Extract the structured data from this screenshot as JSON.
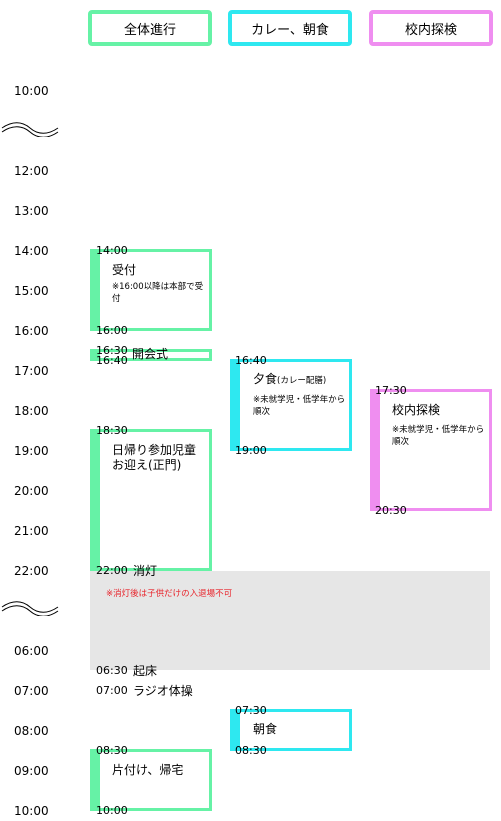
{
  "colors": {
    "general": "#66f2a6",
    "curry": "#2ee8f0",
    "tour": "#ef8ef0",
    "night": "#e6e6e6",
    "warning": "#e8232a"
  },
  "headers": {
    "general": "全体進行",
    "curry": "カレー、朝食",
    "tour": "校内探検"
  },
  "times": {
    "t1000": "10:00",
    "t1200": "12:00",
    "t1300": "13:00",
    "t1400": "14:00",
    "t1500": "15:00",
    "t1600": "16:00",
    "t1700": "17:00",
    "t1800": "18:00",
    "t1900": "19:00",
    "t2000": "20:00",
    "t2100": "21:00",
    "t2200": "22:00",
    "t0600": "06:00",
    "t0700": "07:00",
    "t0800": "08:00",
    "t0900": "09:00",
    "t1000b": "10:00"
  },
  "night_note": "※消灯後は子供だけの入退場不可",
  "events": {
    "reception": {
      "start": "14:00",
      "end": "16:00",
      "title": "受付",
      "note": "※16:00以降は本部で受付"
    },
    "opening": {
      "start": "16:30",
      "end": "16:40",
      "title": "開会式"
    },
    "dinner": {
      "start": "16:40",
      "end": "19:00",
      "title": "夕食",
      "title_small": "(カレー配膳)",
      "note": "※未就学児・低学年から順次"
    },
    "tour": {
      "start": "17:30",
      "end": "20:30",
      "title": "校内探検",
      "note": "※未就学児・低学年から順次"
    },
    "pickup": {
      "start": "18:30",
      "end": "22:00",
      "title": "日帰り参加児童\nお迎え(正門)"
    },
    "lights_out": {
      "time": "22:00",
      "title": "消灯"
    },
    "wake": {
      "time": "06:30",
      "title": "起床"
    },
    "exercise": {
      "time": "07:00",
      "title": "ラジオ体操"
    },
    "breakfast": {
      "start": "07:30",
      "end": "08:30",
      "title": "朝食"
    },
    "cleanup": {
      "start": "08:30",
      "end": "10:00",
      "title": "片付け、帰宅"
    }
  }
}
